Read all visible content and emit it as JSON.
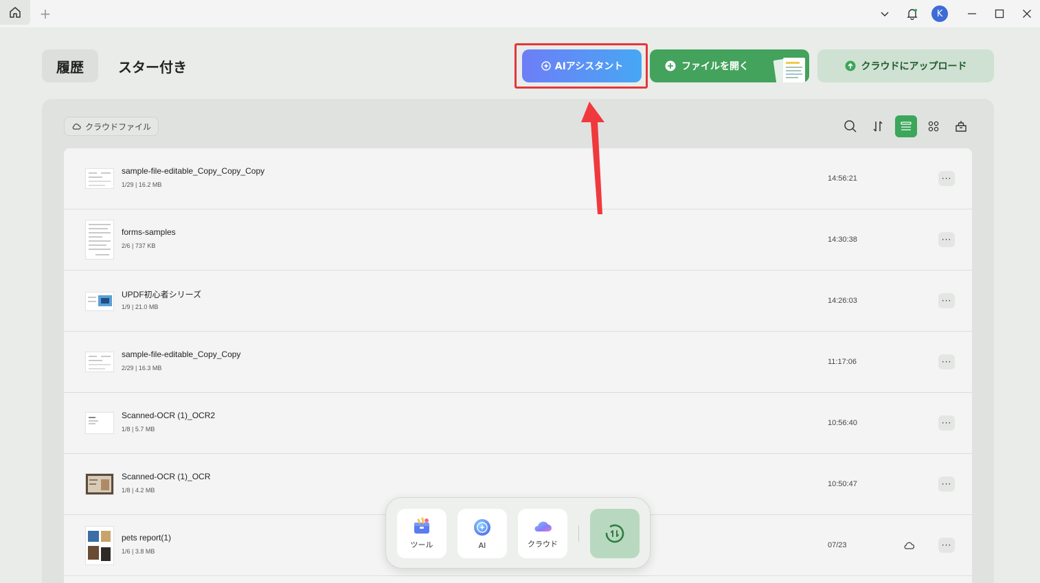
{
  "titlebar": {
    "new_tab_symbol": "+",
    "avatar_initial": "K",
    "icons": [
      "home-icon",
      "plus-icon",
      "chevron-down-icon",
      "bell-icon",
      "minimize-icon",
      "maximize-icon",
      "close-icon"
    ]
  },
  "header": {
    "tab_history": "履歴",
    "tab_starred": "スター付き",
    "ai_assistant_label": "AIアシスタント",
    "open_file_label": "ファイルを開く",
    "upload_label": "クラウドにアップロード"
  },
  "panel": {
    "cloud_files_label": "クラウドファイル",
    "tools": [
      "search-icon",
      "sort-icon",
      "list-view-icon",
      "grid-view-icon",
      "delete-icon"
    ]
  },
  "files": [
    {
      "name": "sample-file-editable_Copy_Copy_Copy",
      "meta": "1/29 | 16.2 MB",
      "time": "14:56:21",
      "cloud": false
    },
    {
      "name": "forms-samples",
      "meta": "2/6 | 737 KB",
      "time": "14:30:38",
      "cloud": false
    },
    {
      "name": "UPDF初心者シリーズ",
      "meta": "1/9 | 21.0 MB",
      "time": "14:26:03",
      "cloud": false
    },
    {
      "name": "sample-file-editable_Copy_Copy",
      "meta": "2/29 | 16.3 MB",
      "time": "11:17:06",
      "cloud": false
    },
    {
      "name": "Scanned-OCR (1)_OCR2",
      "meta": "1/8 | 5.7 MB",
      "time": "10:56:40",
      "cloud": false
    },
    {
      "name": "Scanned-OCR (1)_OCR",
      "meta": "1/8 | 4.2 MB",
      "time": "10:50:47",
      "cloud": false
    },
    {
      "name": "pets report(1)",
      "meta": "1/6 | 3.8 MB",
      "time": "07/23",
      "cloud": true
    }
  ],
  "more_symbol": "···",
  "dock": {
    "tools_label": "ツール",
    "ai_label": "AI",
    "cloud_label": "クラウド"
  },
  "colors": {
    "accent_green": "#43a25c",
    "ai_gradient_start": "#6d7ef6",
    "ai_gradient_end": "#47a7f4",
    "highlight_red": "#e4363a"
  }
}
